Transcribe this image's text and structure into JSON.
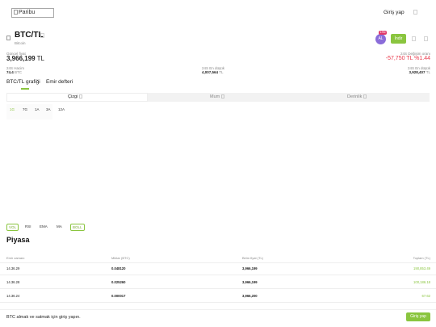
{
  "header": {
    "logo_alt": "Paribu",
    "login_label": "Giriş yap"
  },
  "pair": {
    "title": "BTC/TL",
    "subtitle": "Bitcoin",
    "badge_icon_text": "AL",
    "badge_count": "1SN",
    "download_label": "İndir"
  },
  "stats": {
    "current_label": "Güncel fiyat",
    "current_price": "3,966,199",
    "current_unit": "TL",
    "change_label": "24S Değişim oranı",
    "change_value": "-57,750 TL  %1.44",
    "volume_label": "24S Hacim",
    "volume_value": "74.4",
    "volume_unit": "BTC",
    "low_label": "24S En düşük",
    "low_value": "4,007,564",
    "low_unit": "TL",
    "high_label": "24S En düşük",
    "high_value": "3,928,407",
    "high_unit": "TL"
  },
  "tabs": [
    "BTC/TL grafiği",
    "Emir defteri"
  ],
  "chart_types": [
    "Çizgi",
    "Mum",
    "Derinlik"
  ],
  "ranges": [
    "1G",
    "7G",
    "1A",
    "3A",
    "12A"
  ],
  "indicators": [
    "VOL",
    "RSI",
    "EMA",
    "MA",
    "BOLL"
  ],
  "market": {
    "title": "Piyasa",
    "columns": [
      "Emir zamanı",
      "Miktar (BTC)",
      "Birim fiyat (TL)",
      "Toplam (TL)"
    ],
    "rows": [
      {
        "time": "14.36.29",
        "amount": "0.048120",
        "price": "3,966,199",
        "total": "190,853.49"
      },
      {
        "time": "14.36.28",
        "amount": "0.025260",
        "price": "3,966,199",
        "total": "100,186.18"
      },
      {
        "time": "14.36.24",
        "amount": "0.000017",
        "price": "3,966,200",
        "total": "67.62"
      }
    ]
  },
  "bottom": {
    "text": "BTC almak ve satmak için giriş yapın.",
    "login_label": "Giriş yap"
  },
  "colors": {
    "accent": "#8ac53f",
    "negative": "#e8374a",
    "badge": "#8a6cd9"
  }
}
